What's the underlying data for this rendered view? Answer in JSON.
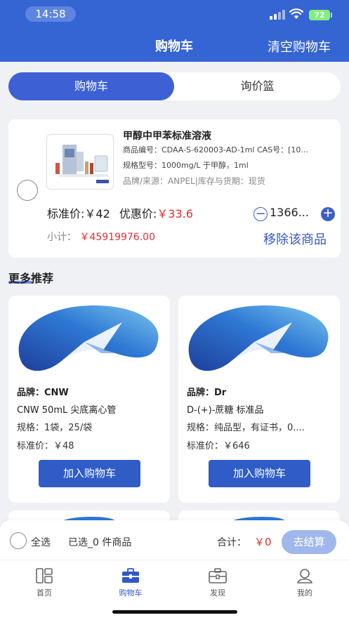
{
  "status_bar": {
    "time": "14:58",
    "battery": "72"
  },
  "header": {
    "title": "购物车",
    "action": "清空购物车"
  },
  "segment": {
    "tabs": [
      "购物车",
      "询价篮"
    ],
    "active": 0
  },
  "cart_item": {
    "title": "甲醇中甲苯标准溶液",
    "code": "商品编号：CDAA-S-620003-AD-1ml    CAS号：[10...",
    "spec": "规格型号：1000mg/L 于甲醇，1ml",
    "brand": "品牌/来源：ANPEL|库存与货期：现货",
    "price_label": "标准价:￥42",
    "discount_label": "优惠价:",
    "discount_value": "￥33.6",
    "quantity": "1366...",
    "subtotal_label": "小计：",
    "subtotal_value": "￥45919976.00",
    "remove_label": "移除该商品"
  },
  "recommend": {
    "title": "更多推荐",
    "items": [
      {
        "brand": "品牌：CNW",
        "name": "CNW 50mL 尖底离心管",
        "spec": "规格：1袋，25/袋",
        "price": "标准价：￥48",
        "button": "加入购物车"
      },
      {
        "brand": "品牌：Dr",
        "name": "D-(+)-蔗糖 标准品",
        "spec": "规格：纯品型，有证书，0....",
        "price": "标准价：￥646",
        "button": "加入购物车"
      }
    ]
  },
  "checkout": {
    "select_all": "全选",
    "selected": "已选_0 件商品",
    "total_label": "合计：",
    "total_value": "￥0",
    "button": "去结算"
  },
  "tabbar": {
    "items": [
      "首页",
      "购物车",
      "发现",
      "我的"
    ],
    "active": 1
  },
  "colors": {
    "primary": "#3565d3",
    "price_red": "#e52d2d",
    "tab_active": "#3357c4"
  }
}
